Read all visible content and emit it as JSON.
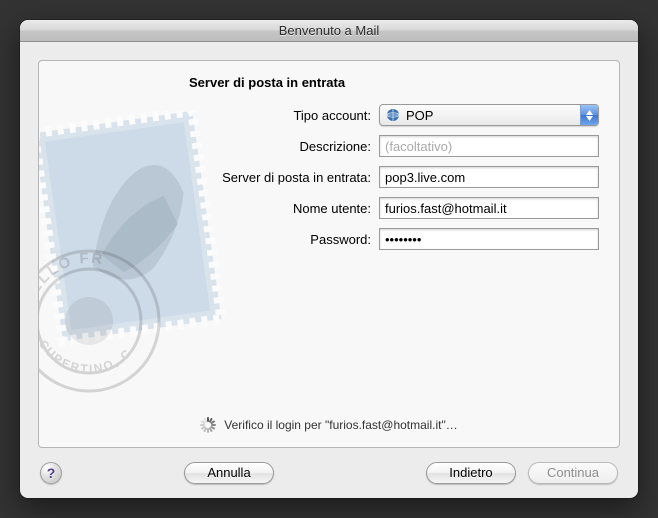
{
  "window": {
    "title": "Benvenuto a Mail"
  },
  "form": {
    "heading": "Server di posta in entrata",
    "account_type": {
      "label": "Tipo account:",
      "value": "POP",
      "icon": "globe-icon"
    },
    "description": {
      "label": "Descrizione:",
      "value": "",
      "placeholder": "(facoltativo)"
    },
    "incoming_server": {
      "label": "Server di posta in entrata:",
      "value": "pop3.live.com"
    },
    "username": {
      "label": "Nome utente:",
      "value": "furios.fast@hotmail.it"
    },
    "password": {
      "label": "Password:",
      "value": "••••••••"
    }
  },
  "status": {
    "text": "Verifico il login per \"furios.fast@hotmail.it\"…"
  },
  "buttons": {
    "help": "?",
    "cancel": "Annulla",
    "back": "Indietro",
    "continue": "Continua",
    "continue_enabled": false
  },
  "icons": {
    "globe": "globe-icon",
    "stamp_bird": "eagle-stamp",
    "postmark_text_top": "HELLO FR",
    "postmark_text_bottom": "CUPERTINO, C"
  }
}
